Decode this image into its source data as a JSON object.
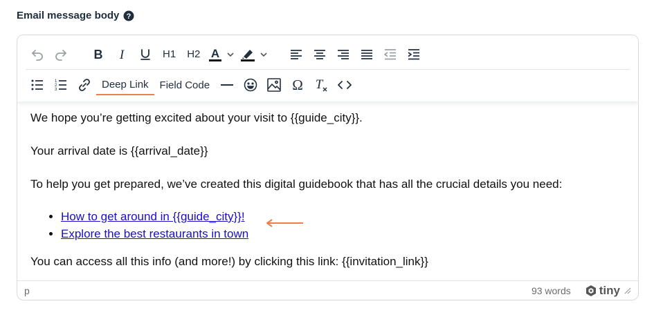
{
  "field": {
    "label": "Email message body"
  },
  "toolbar": {
    "h1_label": "H1",
    "h2_label": "H2",
    "deep_link_label": "Deep Link",
    "field_code_label": "Field Code",
    "accent_color": "#ee7d48"
  },
  "content": {
    "p1": "We hope you’re getting excited about your visit to {{guide_city}}.",
    "p2": "Your arrival date is {{arrival_date}}",
    "p3": "To help you get prepared, we’ve created this digital guidebook that has all the crucial details you need:",
    "links": [
      {
        "text": "How to get around in {{guide_city}}!"
      },
      {
        "text": "Explore the best restaurants in town"
      }
    ],
    "p4": "You can access all this info (and more!) by clicking this link: {{invitation_link}}"
  },
  "statusbar": {
    "path": "p",
    "word_count": "93 words",
    "brand": "tiny"
  },
  "icons": [
    "help-icon",
    "undo-icon",
    "redo-icon",
    "bold-icon",
    "italic-icon",
    "underline-icon",
    "text-color-icon",
    "highlight-icon",
    "chevron-down-icon",
    "align-left-icon",
    "align-center-icon",
    "align-right-icon",
    "justify-icon",
    "outdent-icon",
    "indent-icon",
    "bullet-list-icon",
    "numbered-list-icon",
    "link-icon",
    "horizontal-rule-icon",
    "emoji-icon",
    "image-icon",
    "special-char-icon",
    "clear-format-icon",
    "source-code-icon",
    "arrow-annotation-icon",
    "resize-handle-icon",
    "tiny-logo-icon"
  ]
}
